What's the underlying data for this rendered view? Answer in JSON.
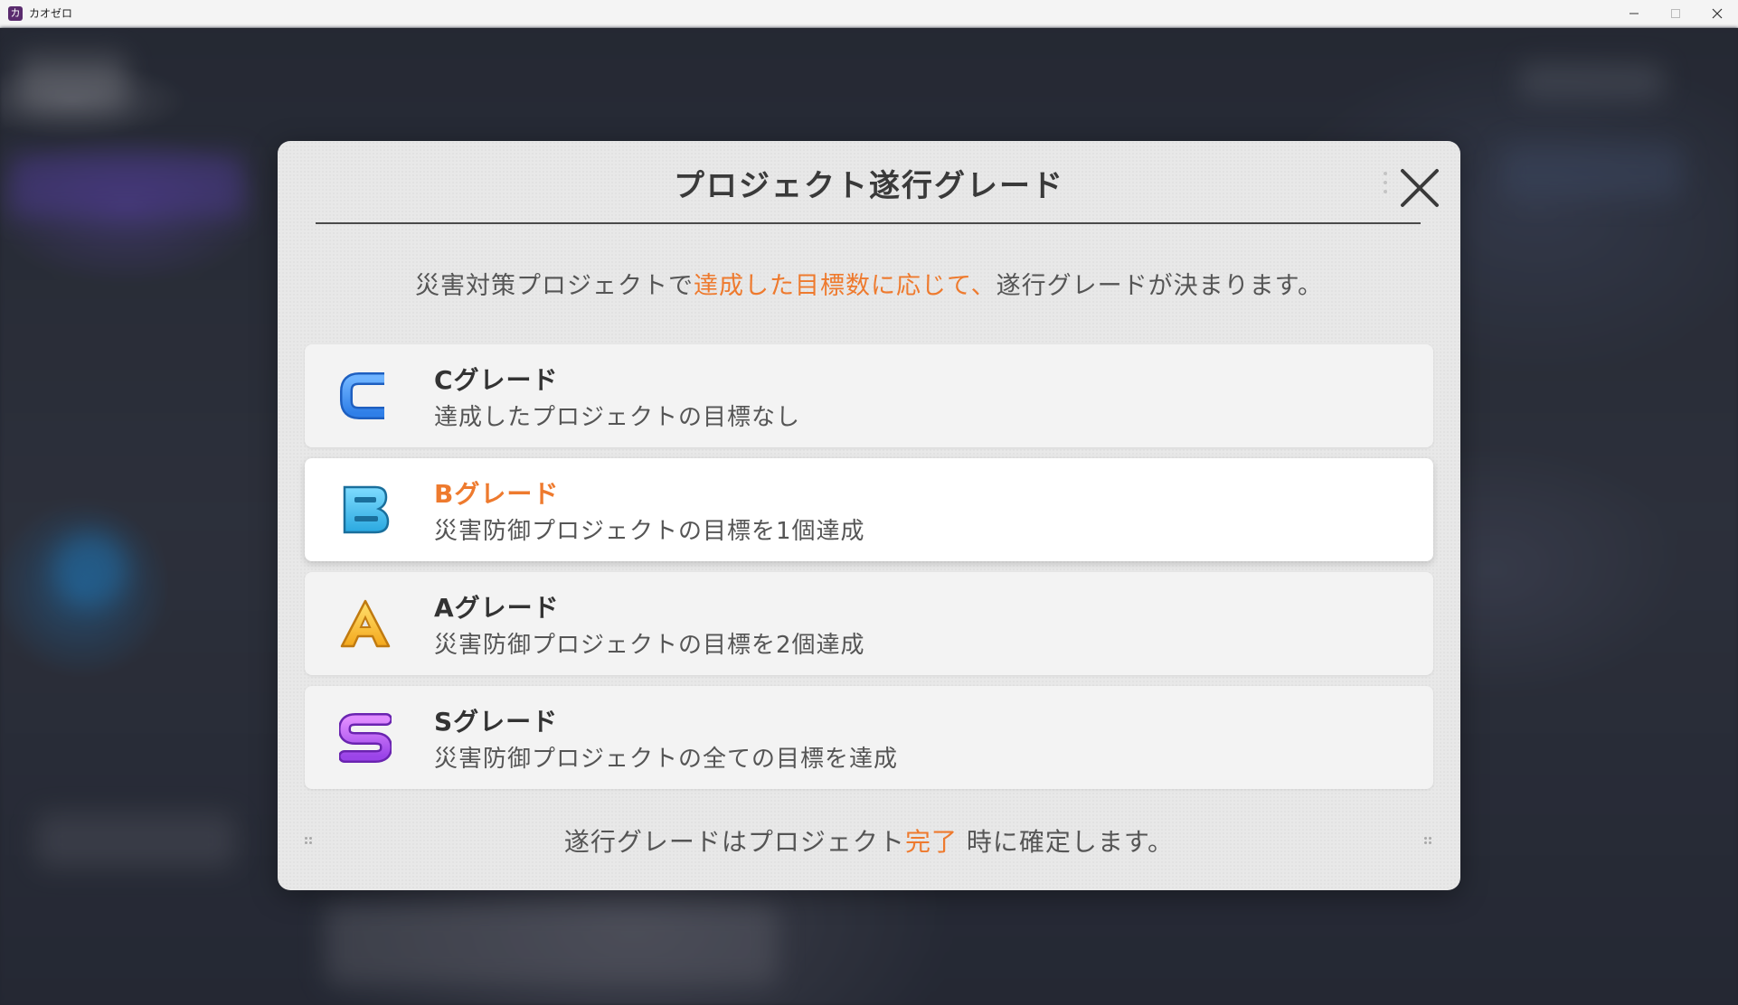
{
  "window": {
    "title": "カオゼロ",
    "app_icon_glyph": "カ"
  },
  "modal": {
    "title": "プロジェクト遂行グレード",
    "lead": {
      "before": "災害対策プロジェクトで",
      "highlight": "達成した目標数に応じて、",
      "after": "遂行グレードが決まります。"
    },
    "grades": [
      {
        "letter": "C",
        "name": "Cグレード",
        "description": "達成したプロジェクトの目標なし",
        "color": "#3b8ff0",
        "icon": "grade-c-icon",
        "selected": false
      },
      {
        "letter": "B",
        "name": "Bグレード",
        "description": "災害防御プロジェクトの目標を1個達成",
        "color": "#35b6e6",
        "icon": "grade-b-icon",
        "selected": true
      },
      {
        "letter": "A",
        "name": "Aグレード",
        "description": "災害防御プロジェクトの目標を2個達成",
        "color": "#f5c02a",
        "icon": "grade-a-icon",
        "selected": false
      },
      {
        "letter": "S",
        "name": "Sグレード",
        "description": "災害防御プロジェクトの全ての目標を達成",
        "color": "#b25ef0",
        "icon": "grade-s-icon",
        "selected": false
      }
    ],
    "footer": {
      "before": "遂行グレードはプロジェクト",
      "highlight": "完了",
      "after": " 時に確定します。"
    }
  },
  "colors": {
    "accent": "#ee7a2e",
    "text": "#555555",
    "modal_bg": "#e8e8e8"
  }
}
